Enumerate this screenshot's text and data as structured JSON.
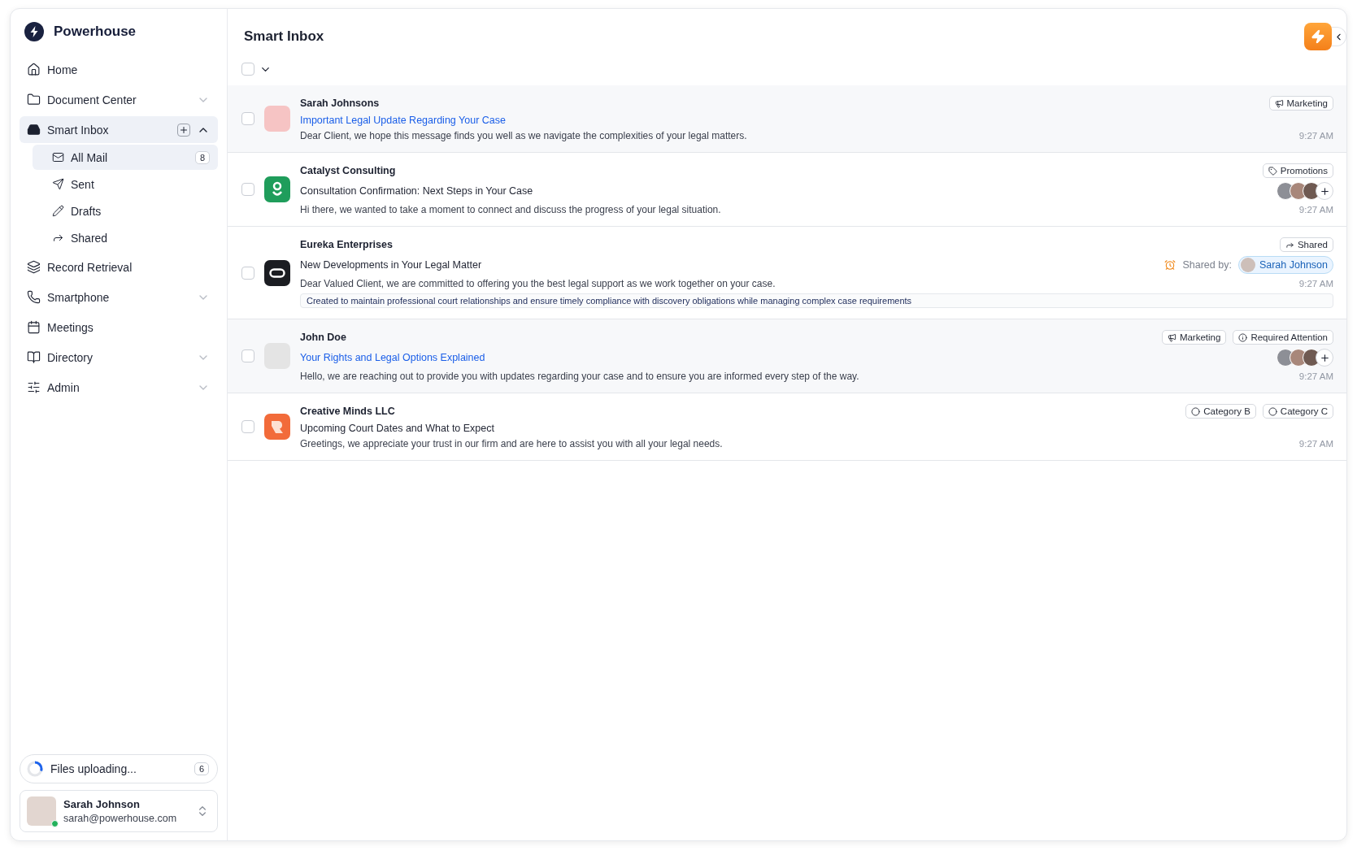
{
  "brand": {
    "name": "Powerhouse"
  },
  "sidebar": {
    "items": [
      {
        "label": "Home",
        "selected": false
      },
      {
        "label": "Document Center",
        "selected": false,
        "expanded": false
      },
      {
        "label": "Smart Inbox",
        "selected": true,
        "expanded": true,
        "children": [
          {
            "label": "All Mail",
            "selected": true,
            "badge": "8"
          },
          {
            "label": "Sent",
            "selected": false
          },
          {
            "label": "Drafts",
            "selected": false
          },
          {
            "label": "Shared",
            "selected": false
          }
        ]
      },
      {
        "label": "Record Retrieval",
        "selected": false
      },
      {
        "label": "Smartphone",
        "selected": false,
        "expanded": false
      },
      {
        "label": "Meetings",
        "selected": false
      },
      {
        "label": "Directory",
        "selected": false,
        "expanded": false
      },
      {
        "label": "Admin",
        "selected": false,
        "expanded": false
      }
    ]
  },
  "upload": {
    "label": "Files uploading...",
    "count": "6",
    "level": 0.3
  },
  "user": {
    "name": "Sarah Johnson",
    "email": "sarah@powerhouse.com",
    "online": true
  },
  "header": {
    "title": "Smart Inbox",
    "select_all": {
      "checked": false
    }
  },
  "messages": [
    {
      "sender": "Sarah Johnsons",
      "avatar": {
        "kind": "photo",
        "color": "#f6c4c4"
      },
      "subject": "Important Legal Update Regarding Your Case",
      "preview": "Dear Client, we hope this message finds you well as we navigate the complexities of your legal matters.",
      "unread": true,
      "checked": false,
      "tags": [
        {
          "kind": "megaphone",
          "label": "Marketing"
        }
      ],
      "assignees": false,
      "time": "9:27 AM"
    },
    {
      "sender": "Catalyst Consulting",
      "avatar": {
        "kind": "logo-g",
        "color": "#1f9d5b"
      },
      "subject": "Consultation Confirmation: Next Steps in Your Case",
      "preview": "Hi there, we wanted to take a moment to connect and discuss the progress of your legal situation.",
      "unread": false,
      "checked": false,
      "tags": [
        {
          "kind": "tag",
          "label": "Promotions"
        }
      ],
      "assignees": true,
      "time": "9:27 AM"
    },
    {
      "sender": "Eureka Enterprises",
      "avatar": {
        "kind": "logo-pill",
        "color": "#1b1d22"
      },
      "subject": "New Developments in Your Legal Matter",
      "preview": "Dear Valued Client, we are committed to offering you the best legal support as we work together on your case.",
      "unread": false,
      "checked": false,
      "tags": [
        {
          "kind": "share",
          "label": "Shared"
        }
      ],
      "assignees": false,
      "shared_by": {
        "label": "Shared by:",
        "name": "Sarah Johnson"
      },
      "note": "Created to maintain professional court relationships and ensure timely compliance with discovery obligations while managing complex case requirements",
      "time": "9:27 AM"
    },
    {
      "sender": "John Doe",
      "avatar": {
        "kind": "photo",
        "color": "#e4e4e4"
      },
      "subject": "Your Rights and Legal Options Explained",
      "preview": "Hello, we are reaching out to provide you with updates regarding your case and to ensure you are informed every step of the way.",
      "unread": true,
      "checked": false,
      "tags": [
        {
          "kind": "megaphone",
          "label": "Marketing"
        },
        {
          "kind": "info",
          "label": "Required Attention"
        }
      ],
      "assignees": true,
      "time": "9:27 AM"
    },
    {
      "sender": "Creative Minds LLC",
      "avatar": {
        "kind": "logo-r",
        "color": "#f26b3a"
      },
      "subject": "Upcoming Court Dates and What to Expect",
      "preview": "Greetings, we appreciate your trust in our firm and are here to assist you with all your legal needs.",
      "unread": false,
      "checked": false,
      "tags": [
        {
          "kind": "circle",
          "label": "Category B"
        },
        {
          "kind": "circle",
          "label": "Category C"
        }
      ],
      "assignees": false,
      "time": "9:27 AM"
    }
  ]
}
